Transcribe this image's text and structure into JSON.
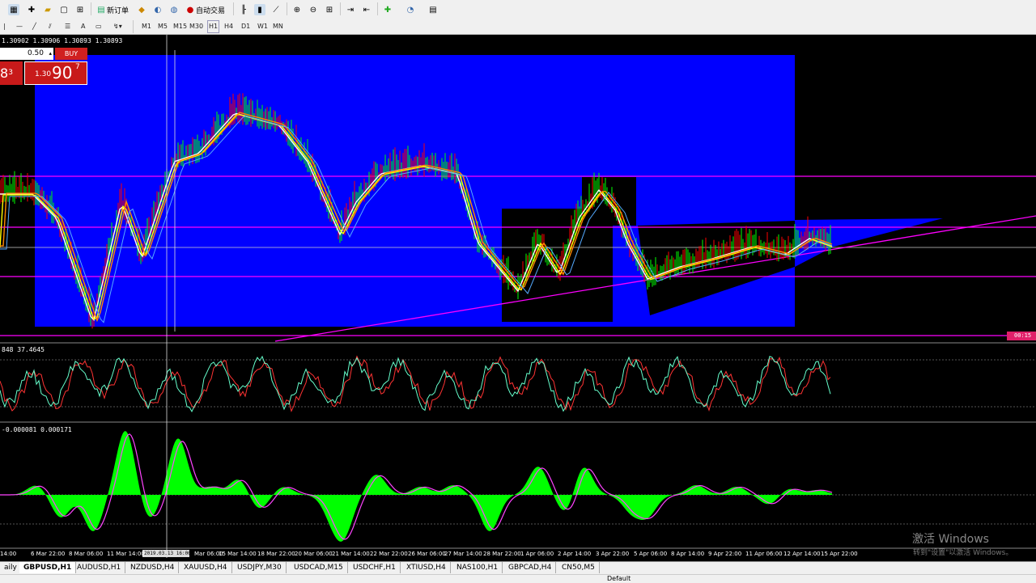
{
  "toolbar": {
    "new_order_label": "新订单",
    "auto_trading_label": "自动交易",
    "timeframes": [
      "M1",
      "M5",
      "M15",
      "M30",
      "H1",
      "H4",
      "D1",
      "W1",
      "MN"
    ]
  },
  "chart": {
    "info_line": "1.30902 1.30906 1.30893 1.30893",
    "lot_value": "0.50",
    "buy_label": "BUY",
    "sell_price_digits": "8",
    "sell_price_sup": "3",
    "buy_price_prefix": "1.30",
    "buy_price_big": "90",
    "buy_price_sup": "7",
    "osc1_label": "848 37.4645",
    "osc2_label": "-0.000081 0.000171",
    "price_tag": "00:15",
    "crosshair_date": "2019.03.13 16:00",
    "x_labels": [
      "14:00",
      "6 Mar 22:00",
      "8 Mar 06:00",
      "11 Mar 14:00",
      "Mar 06:00",
      "15 Mar 14:00",
      "18 Mar 22:00",
      "20 Mar 06:00",
      "21 Mar 14:00",
      "22 Mar 22:00",
      "26 Mar 06:00",
      "27 Mar 14:00",
      "28 Mar 22:00",
      "1 Apr 06:00",
      "2 Apr 14:00",
      "3 Apr 22:00",
      "5 Apr 06:00",
      "8 Apr 14:00",
      "9 Apr 22:00",
      "11 Apr 06:00",
      "12 Apr 14:00",
      "15 Apr 22:00"
    ]
  },
  "tabs": [
    "aily",
    "GBPUSD,H1",
    "AUDUSD,H1",
    "NZDUSD,H4",
    "XAUUSD,H4",
    "USDJPY,M30",
    "USDCAD,M15",
    "USDCHF,H1",
    "XTIUSD,H4",
    "NAS100,H1",
    "GBPCAD,H4",
    "CN50,M5"
  ],
  "status": {
    "profile": "Default"
  },
  "watermark": {
    "title": "激活 Windows",
    "subtitle": "转到\"设置\"以激活 Windows。"
  },
  "colors": {
    "rect_blue": "#0000ff",
    "bull_candle": "#00ff00",
    "bear_candle": "#ff0000",
    "hline": "#ff00ff",
    "histogram": "#00ff00"
  }
}
